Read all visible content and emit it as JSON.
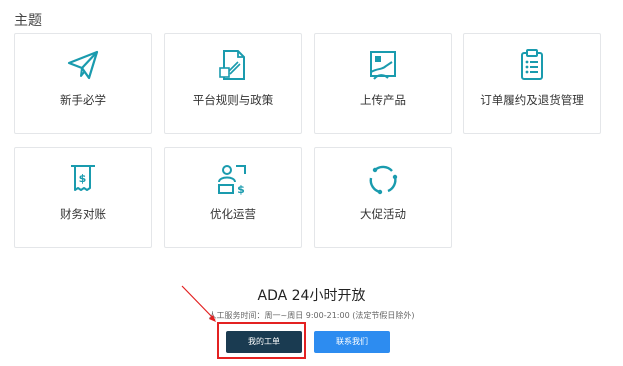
{
  "section": {
    "title": "主题"
  },
  "cards": [
    {
      "label": "新手必学",
      "icon": "paper-plane-icon"
    },
    {
      "label": "平台规则与政策",
      "icon": "document-rules-icon"
    },
    {
      "label": "上传产品",
      "icon": "upload-product-icon"
    },
    {
      "label": "订单履约及退货管理",
      "icon": "clipboard-list-icon"
    },
    {
      "label": "财务对账",
      "icon": "finance-receipt-icon"
    },
    {
      "label": "优化运营",
      "icon": "operations-icon"
    },
    {
      "label": "大促活动",
      "icon": "refresh-cycle-icon"
    }
  ],
  "support": {
    "title": "ADA 24小时开放",
    "hours": "人工服务时间：周一~周日 9:00-21:00 (法定节假日除外)",
    "ticket_button": "我的工单",
    "contact_button": "联系我们"
  },
  "colors": {
    "icon": "#1a9bae",
    "ticket_button": "#1a3b51",
    "contact_button": "#2d8cf0",
    "highlight": "#e32121"
  }
}
